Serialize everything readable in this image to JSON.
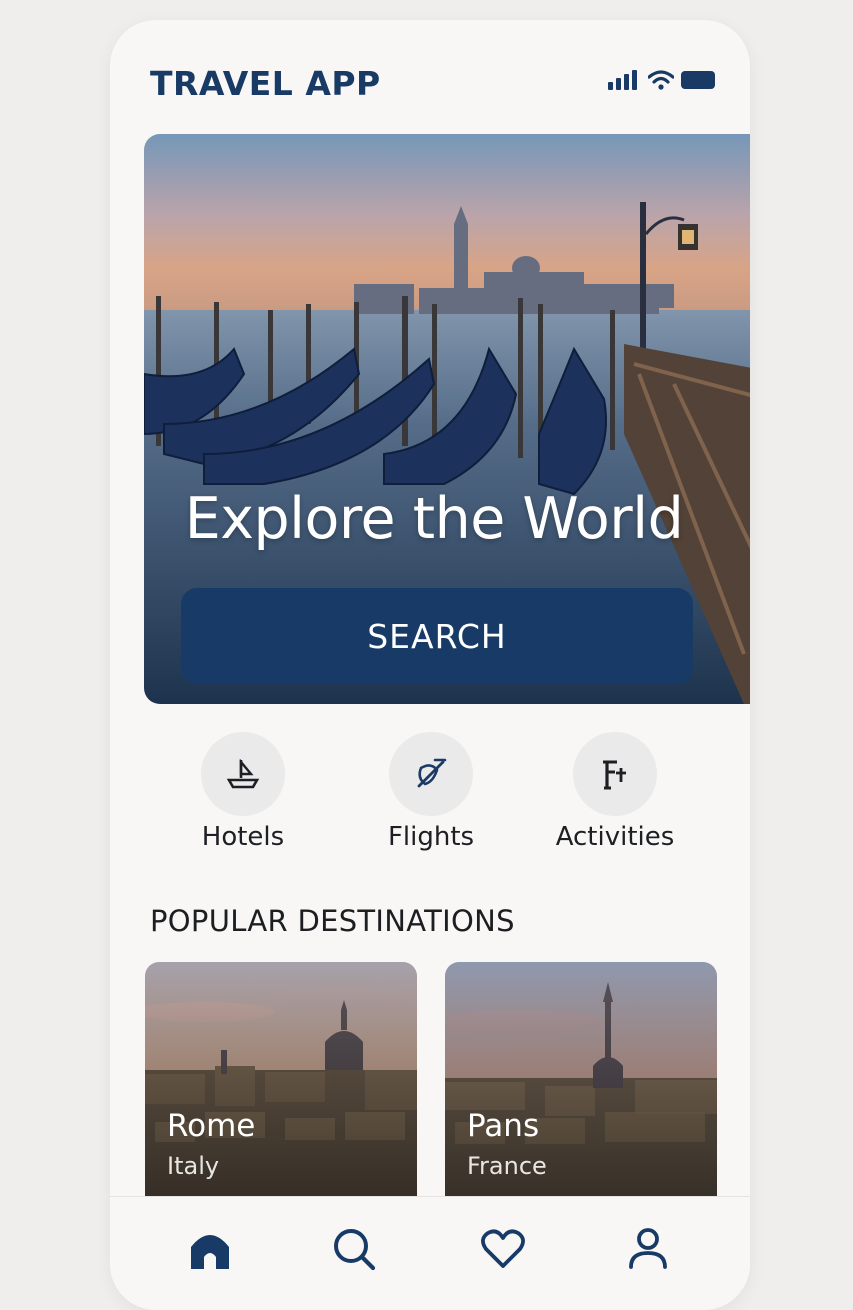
{
  "app": {
    "title": "TRAVEL APP"
  },
  "status_bar": {
    "icons": [
      "signal-icon",
      "wifi-icon",
      "battery-icon"
    ]
  },
  "hero": {
    "headline": "Explore the World",
    "search_label": "SEARCH"
  },
  "categories": [
    {
      "label": "Hotels",
      "icon": "boat-icon"
    },
    {
      "label": "Flights",
      "icon": "plane-icon"
    },
    {
      "label": "Activities",
      "icon": "activity-icon"
    }
  ],
  "popular": {
    "title": "POPULAR DESTINATIONS",
    "destinations": [
      {
        "city": "Rome",
        "country": "Italy"
      },
      {
        "city": "Pans",
        "country": "France"
      }
    ]
  },
  "bottom_nav": {
    "items": [
      "home-icon",
      "search-icon",
      "heart-icon",
      "profile-icon"
    ]
  },
  "colors": {
    "primary": "#173a67",
    "background": "#f8f7f5"
  }
}
